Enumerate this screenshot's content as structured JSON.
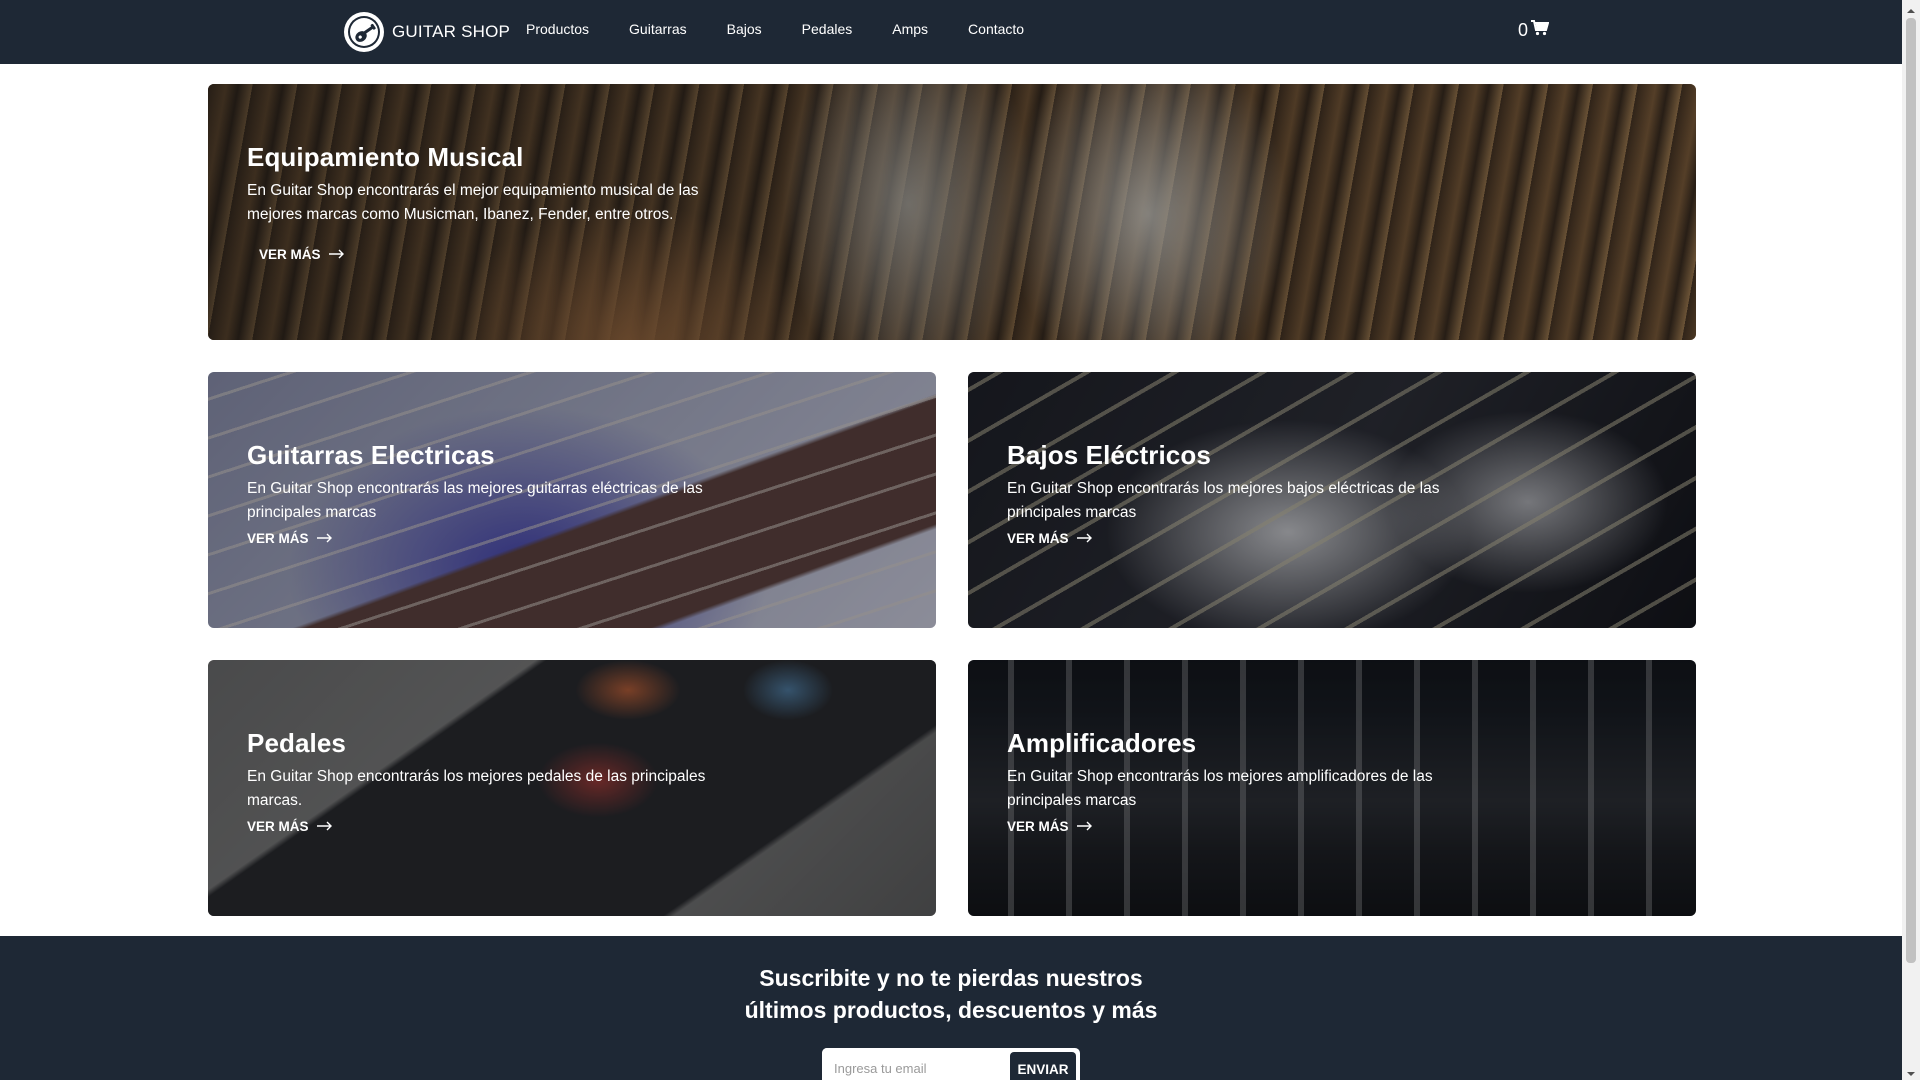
{
  "navbar": {
    "brand": "GUITAR SHOP",
    "brand_logo_icon": "guitar-logo-icon",
    "links": [
      "Productos",
      "Guitarras",
      "Bajos",
      "Pedales",
      "Amps",
      "Contacto"
    ],
    "cart_count": "0",
    "cart_icon": "cart-icon"
  },
  "cards": {
    "hero": {
      "title": "Equipamiento Musical",
      "text_line1": "En Guitar Shop encontrarás el mejor equipamiento musical de las",
      "text_line2": "mejores marcas como Musicman, Ibanez, Fender, entre otros.",
      "link": "VER MÁS"
    },
    "guitars": {
      "title": "Guitarras Electricas",
      "text_line1": "En Guitar Shop encontrarás las mejores guitarras eléctricas de las",
      "text_line2": "principales marcas",
      "link": "VER MÁS"
    },
    "bass": {
      "title": "Bajos Eléctricos",
      "text_line1": "En Guitar Shop encontrarás los mejores bajos eléctricas de las",
      "text_line2": "principales marcas",
      "link": "VER MÁS"
    },
    "pedals": {
      "title": "Pedales",
      "text_line1": "En Guitar Shop encontrarás los mejores pedales de las principales",
      "text_line2": "marcas.",
      "link": "VER MÁS"
    },
    "amps": {
      "title": "Amplificadores",
      "text_line1": "En Guitar Shop encontrarás los mejores amplificadores de las",
      "text_line2": "principales marcas",
      "link": "VER MÁS"
    }
  },
  "footer": {
    "title_line1": "Suscribite y no te pierdas nuestros",
    "title_line2": "últimos productos, descuentos y más",
    "email_placeholder": "Ingresa tu email",
    "send_label": "ENVIAR"
  },
  "colors": {
    "navbar_bg": "#1e2835",
    "footer_bg": "#1e2835",
    "text_on_dark": "#ffffff"
  }
}
